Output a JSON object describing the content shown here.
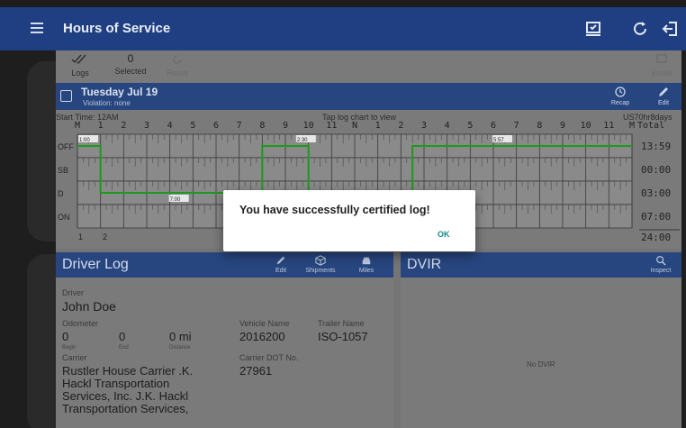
{
  "app_bar": {
    "title": "Hours of Service",
    "icons": [
      "menu-icon",
      "certify-icon",
      "refresh-icon",
      "logout-icon"
    ]
  },
  "toolbar": {
    "logs_label": "Logs",
    "selected_count": "0",
    "selected_label": "Selected",
    "reset_label": "Reset",
    "email_label": "Email"
  },
  "day": {
    "date": "Tuesday Jul 19",
    "violation": "Violation: none",
    "recap_label": "Recap",
    "edit_label": "Edit"
  },
  "graph": {
    "start_time": "Start Time: 12AM",
    "hint": "Tap log chart to view",
    "cycle": "US70hr8days",
    "hours": [
      "M",
      "1",
      "2",
      "3",
      "4",
      "5",
      "6",
      "7",
      "8",
      "9",
      "10",
      "11",
      "N",
      "1",
      "2",
      "3",
      "4",
      "5",
      "6",
      "7",
      "8",
      "9",
      "10",
      "11",
      "M"
    ],
    "total_label": "Total",
    "rows": [
      {
        "label": "OFF",
        "total": "13:59"
      },
      {
        "label": "SB",
        "total": "00:00"
      },
      {
        "label": "D",
        "total": "03:00"
      },
      {
        "label": "ON",
        "total": "07:00"
      }
    ],
    "grand_total": "24:00",
    "bottom_markers": [
      "1",
      "2"
    ],
    "small_labels": [
      "1:00",
      "2:30",
      "7:00",
      "5:57"
    ],
    "line_color": "#1c9a1c"
  },
  "driver_log": {
    "title": "Driver Log",
    "edit_label": "Edit",
    "shipments_label": "Shipments",
    "miles_label": "Miles",
    "driver_label": "Driver",
    "driver_name": "John Doe",
    "odometer_label": "Odometer",
    "begin_value": "0",
    "begin_label": "Begin",
    "end_value": "0",
    "end_label": "End",
    "distance_value": "0 mi",
    "distance_label": "Distance",
    "vehicle_label": "Vehicle Name",
    "vehicle_value": "2016200",
    "trailer_label": "Trailer Name",
    "trailer_value": "ISO-1057",
    "carrier_label": "Carrier",
    "carrier_lines": [
      "Rustler House Carrier .K.",
      "Hackl Transportation",
      "Services, Inc. J.K. Hackl",
      "Transportation Services,"
    ],
    "dot_label": "Carrier DOT No.",
    "dot_value": "27961"
  },
  "dvir": {
    "title": "DVIR",
    "inspect_label": "Inspect",
    "empty_text": "No DVIR"
  },
  "dialog": {
    "message": "You have successfully certified log!",
    "ok_label": "OK"
  },
  "colors": {
    "app_bar": "#203f82",
    "header": "#27467f",
    "accent": "#158a88"
  }
}
